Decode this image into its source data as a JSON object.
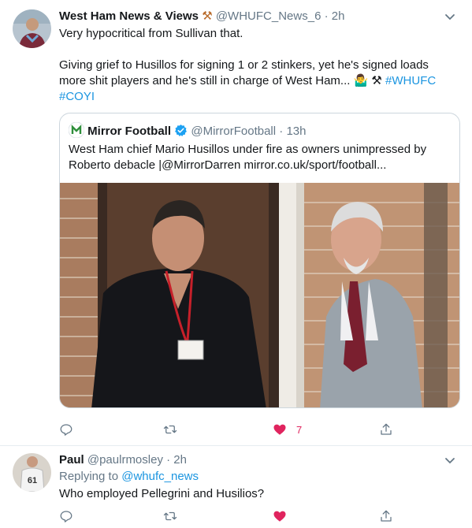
{
  "main_tweet": {
    "author_name": "West Ham News & Views",
    "author_emoji": "⚒",
    "handle": "@WHUFC_News_6",
    "separator": "·",
    "time": "2h",
    "line1": "Very hypocritical from Sullivan that.",
    "line2": "Giving grief to Husillos for signing 1 or 2 stinkers, yet he's signed loads more shit players and he's still in charge of West Ham...",
    "inline_emoji": "🤷‍♂️ ⚒",
    "hashtag1": "#WHUFC",
    "hashtag2": "#COYI",
    "quote": {
      "author_name": "Mirror Football",
      "verified_icon": "verified-badge-icon",
      "handle": "@MirrorFootball",
      "separator": "·",
      "time": "13h",
      "text": "West Ham chief Mario Husillos under fire as owners unimpressed by Roberto debacle |@MirrorDarren mirror.co.uk/sport/football..."
    },
    "actions": {
      "reply_count": "",
      "retweet_count": "",
      "like_count": "7",
      "liked": true,
      "like_color": "#e0245e",
      "icon_color": "#657786"
    }
  },
  "reply_tweet": {
    "author_name": "Paul",
    "handle": "@paulrmosley",
    "separator": "·",
    "time": "2h",
    "replying_prefix": "Replying to",
    "replying_handle": "@whufc_news",
    "text": "Who employed Pellegrini and Husilios?",
    "avatar_shirt_number": "61",
    "actions": {
      "liked": true
    }
  },
  "colors": {
    "link": "#1b95e0",
    "secondary_text": "#657786",
    "border": "#e6ecf0",
    "like": "#e0245e",
    "verified": "#1da1f2"
  }
}
